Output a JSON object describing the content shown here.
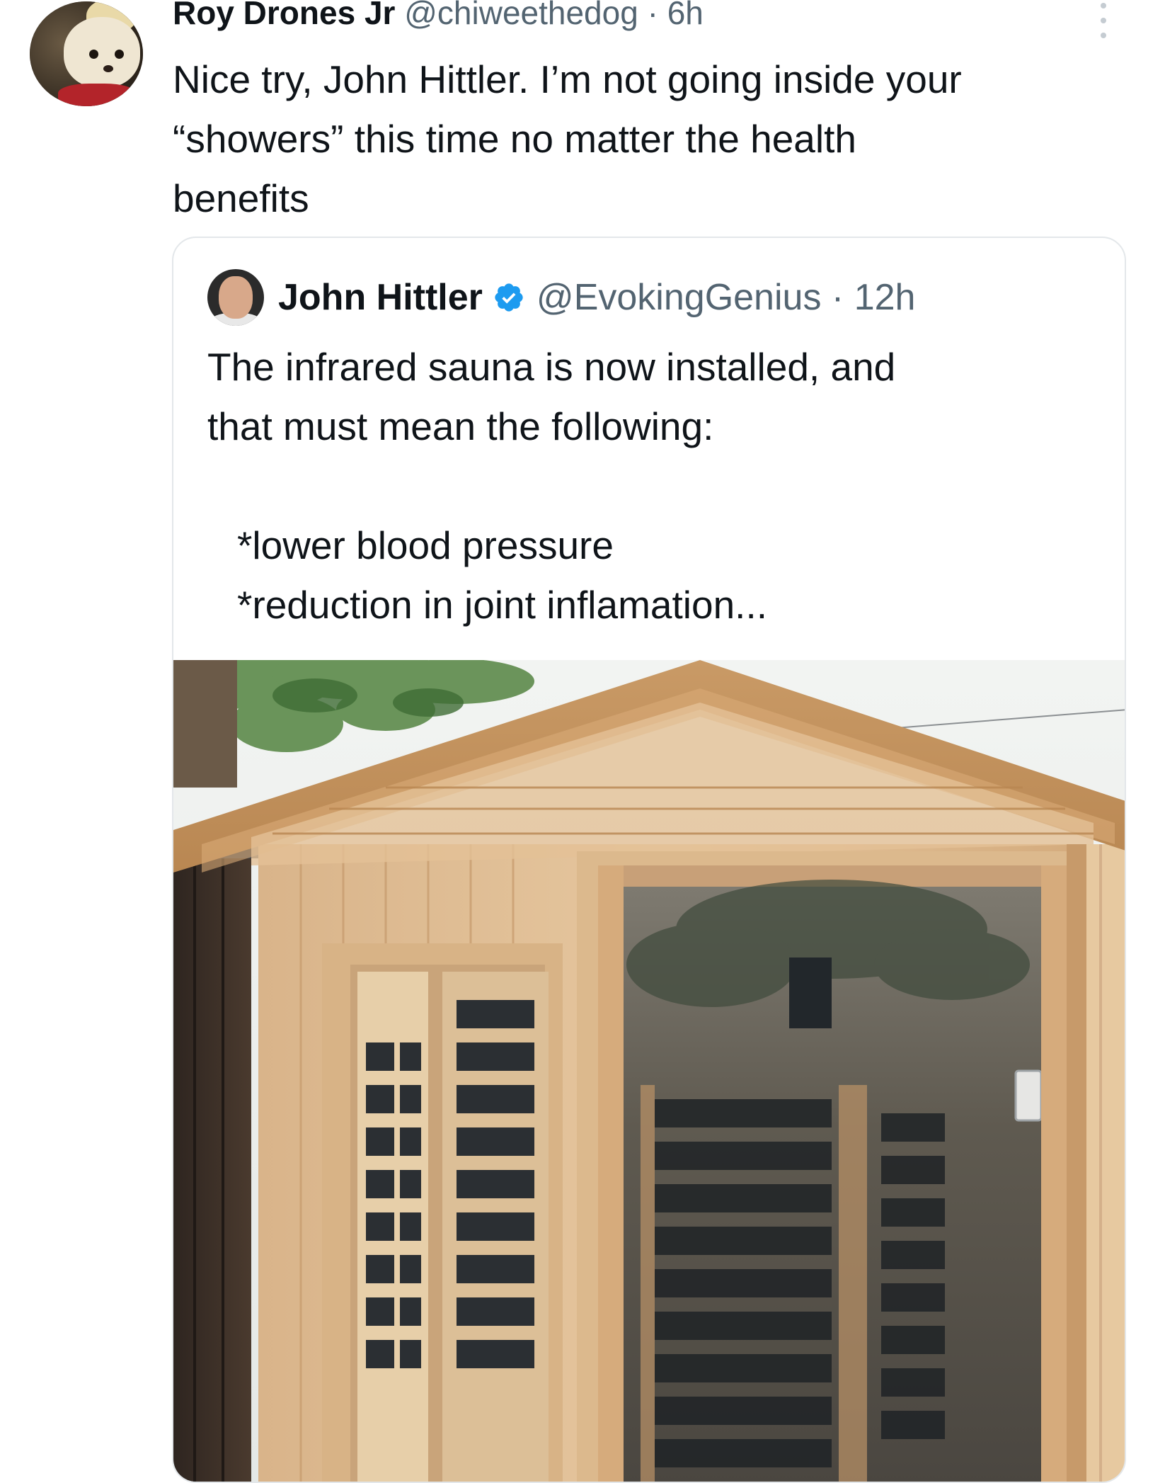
{
  "post": {
    "author_name": "Roy Drones Jr",
    "author_handle": "@chiweethedog",
    "separator": "·",
    "time": "6h",
    "text_lines": [
      "Nice try, John Hittler. I’m not going inside your",
      "“showers” this time no matter the health",
      "benefits"
    ]
  },
  "quoted": {
    "author_name": "John Hittler",
    "author_handle": "@EvokingGenius",
    "separator": "·",
    "time": "12h",
    "text_lines": [
      "The infrared sauna is now installed, and",
      "that must mean the following:"
    ],
    "bullets": [
      "*lower blood pressure",
      "*reduction in joint inflamation..."
    ]
  },
  "icons": {
    "more": "more-options-icon",
    "verified": "verified-badge-icon"
  },
  "colors": {
    "text_primary": "#0f1419",
    "text_secondary": "#536471",
    "verified_blue": "#1d9bf0",
    "card_border": "#e3e7ea"
  }
}
